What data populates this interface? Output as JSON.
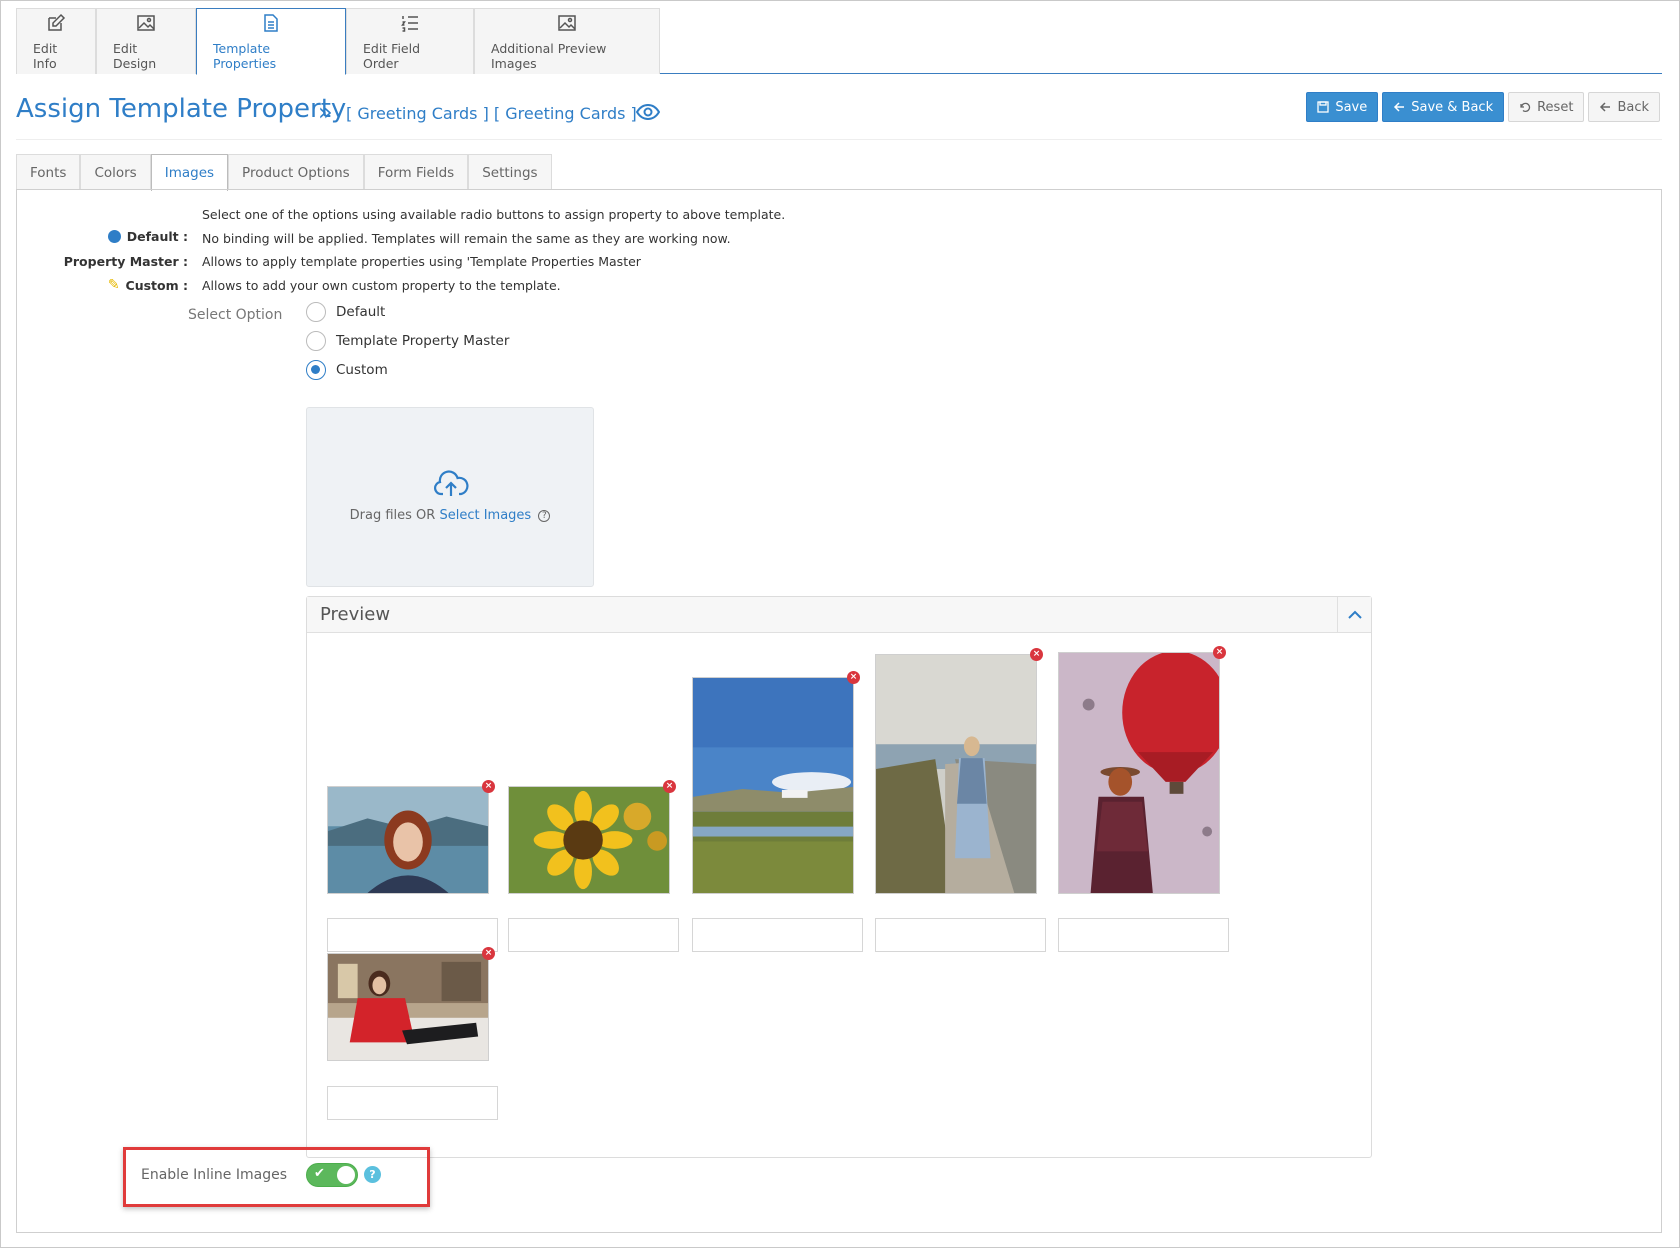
{
  "top_tabs": [
    {
      "label": "Edit Info",
      "icon": "edit-icon"
    },
    {
      "label": "Edit Design",
      "icon": "image-icon"
    },
    {
      "label": "Template Properties",
      "icon": "document-icon"
    },
    {
      "label": "Edit Field Order",
      "icon": "ordered-list-icon"
    },
    {
      "label": "Additional Preview Images",
      "icon": "image-icon"
    }
  ],
  "header": {
    "title": "Assign Template Property",
    "chevron": "»",
    "breadcrumb": "[ Greeting Cards ] [ Greeting Cards ]"
  },
  "actions": {
    "save": "Save",
    "save_back": "Save & Back",
    "reset": "Reset",
    "back": "Back"
  },
  "sub_tabs": [
    "Fonts",
    "Colors",
    "Images",
    "Product Options",
    "Form Fields",
    "Settings"
  ],
  "legend": {
    "intro": "Select one of the options using available radio buttons to assign property to above template.",
    "default_key": "Default :",
    "default_desc": "No binding will be applied. Templates will remain the same as they are working now.",
    "master_key": "Property Master :",
    "master_desc": "Allows to apply template properties using 'Template Properties Master",
    "custom_key": "Custom :",
    "custom_desc": "Allows to add your own custom property to the template."
  },
  "select_option": {
    "label": "Select Option",
    "options": [
      "Default",
      "Template Property Master",
      "Custom"
    ],
    "selected": "Custom"
  },
  "dropzone": {
    "text": "Drag files OR",
    "link": "Select Images",
    "help": "?"
  },
  "preview": {
    "title": "Preview",
    "remove_glyph": "×",
    "images": [
      {
        "subject": "portrait-woman-lake"
      },
      {
        "subject": "sunflower"
      },
      {
        "subject": "landscape-house-field"
      },
      {
        "subject": "woman-coastal-path"
      },
      {
        "subject": "woman-hot-air-balloon"
      },
      {
        "subject": "woman-red-jacket-sofa"
      }
    ]
  },
  "inline_images": {
    "label": "Enable Inline Images",
    "enabled": true,
    "check": "✔",
    "help": "?"
  },
  "colors": {
    "accent": "#2f7ec7",
    "remove": "#d9363e",
    "toggle_on": "#5cb85c",
    "highlight": "#e03b3b"
  }
}
